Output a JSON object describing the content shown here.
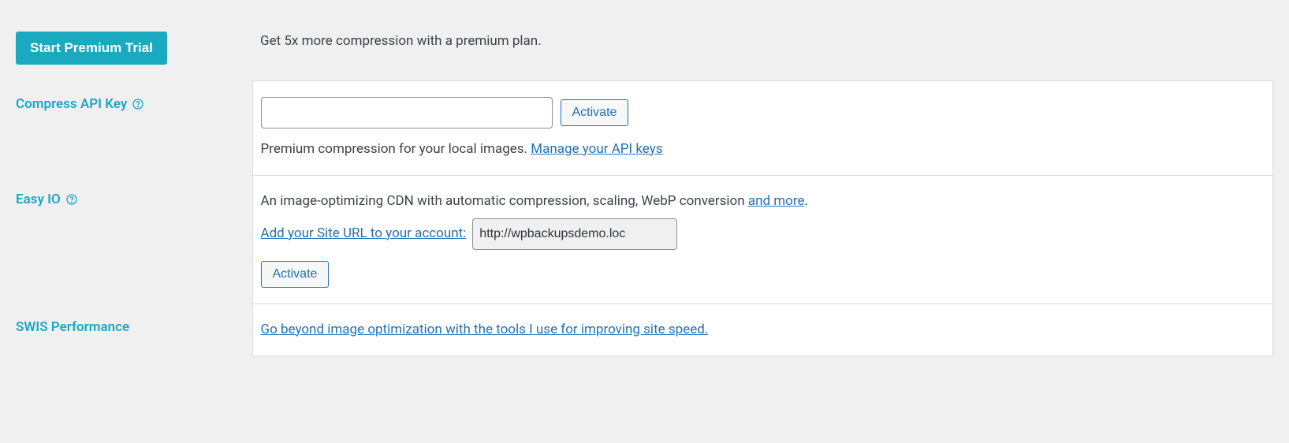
{
  "premium": {
    "button_label": "Start Premium Trial",
    "description": "Get 5x more compression with a premium plan."
  },
  "compress": {
    "label": "Compress API Key",
    "activate_label": "Activate",
    "desc_text": "Premium compression for your local images.",
    "manage_link": "Manage your API keys"
  },
  "easyio": {
    "label": "Easy IO",
    "desc_pre": "An image-optimizing CDN with automatic compression, scaling, WebP conversion ",
    "and_more": "and more",
    "desc_post": ".",
    "add_url_label": "Add your Site URL to your account:",
    "site_url": "http://wpbackupsdemo.loc",
    "activate_label": "Activate"
  },
  "swis": {
    "label": "SWIS Performance",
    "link_text": "Go beyond image optimization with the tools I use for improving site speed."
  }
}
